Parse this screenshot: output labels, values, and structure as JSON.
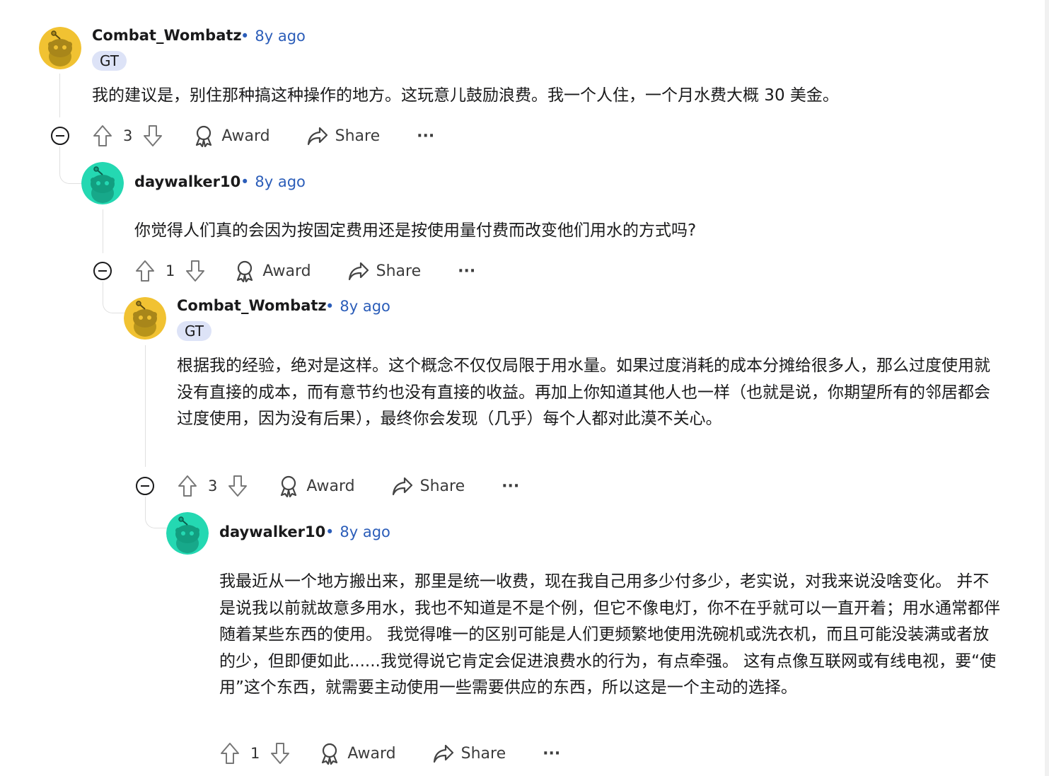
{
  "comments": [
    {
      "username": "Combat_Wombatz",
      "time": "8y ago",
      "flair": "GT",
      "body": "我的建议是，别住那种搞这种操作的地方。这玩意儿鼓励浪费。我一个人住，一个月水费大概 30 美金。",
      "votes": "3",
      "avatar_color": "#e8be2b"
    },
    {
      "username": "daywalker10",
      "time": "8y ago",
      "body": "你觉得人们真的会因为按固定费用还是按使用量付费而改变他们用水的方式吗?",
      "votes": "1",
      "avatar_color": "#1fd8b5"
    },
    {
      "username": "Combat_Wombatz",
      "time": "8y ago",
      "flair": "GT",
      "body": "根据我的经验，绝对是这样。这个概念不仅仅局限于用水量。如果过度消耗的成本分摊给很多人，那么过度使用就没有直接的成本，而有意节约也没有直接的收益。再加上你知道其他人也一样（也就是说，你期望所有的邻居都会过度使用，因为没有后果），最终你会发现（几乎）每个人都对此漠不关心。",
      "votes": "3",
      "avatar_color": "#e8be2b"
    },
    {
      "username": "daywalker10",
      "time": "8y ago",
      "body": "我最近从一个地方搬出来，那里是统一收费，现在我自己用多少付多少，老实说，对我来说没啥变化。 并不是说我以前就故意多用水，我也不知道是不是个例，但它不像电灯，你不在乎就可以一直开着；用水通常都伴随着某些东西的使用。 我觉得唯一的区别可能是人们更频繁地使用洗碗机或洗衣机，而且可能没装满或者放的少，但即便如此......我觉得说它肯定会促进浪费水的行为，有点牵强。 这有点像互联网或有线电视，要“使用”这个东西，就需要主动使用一些需要供应的东西，所以这是一个主动的选择。",
      "votes": "1",
      "avatar_color": "#1fd8b5"
    }
  ],
  "labels": {
    "award": "Award",
    "share": "Share",
    "more": "···",
    "dot": "•"
  }
}
